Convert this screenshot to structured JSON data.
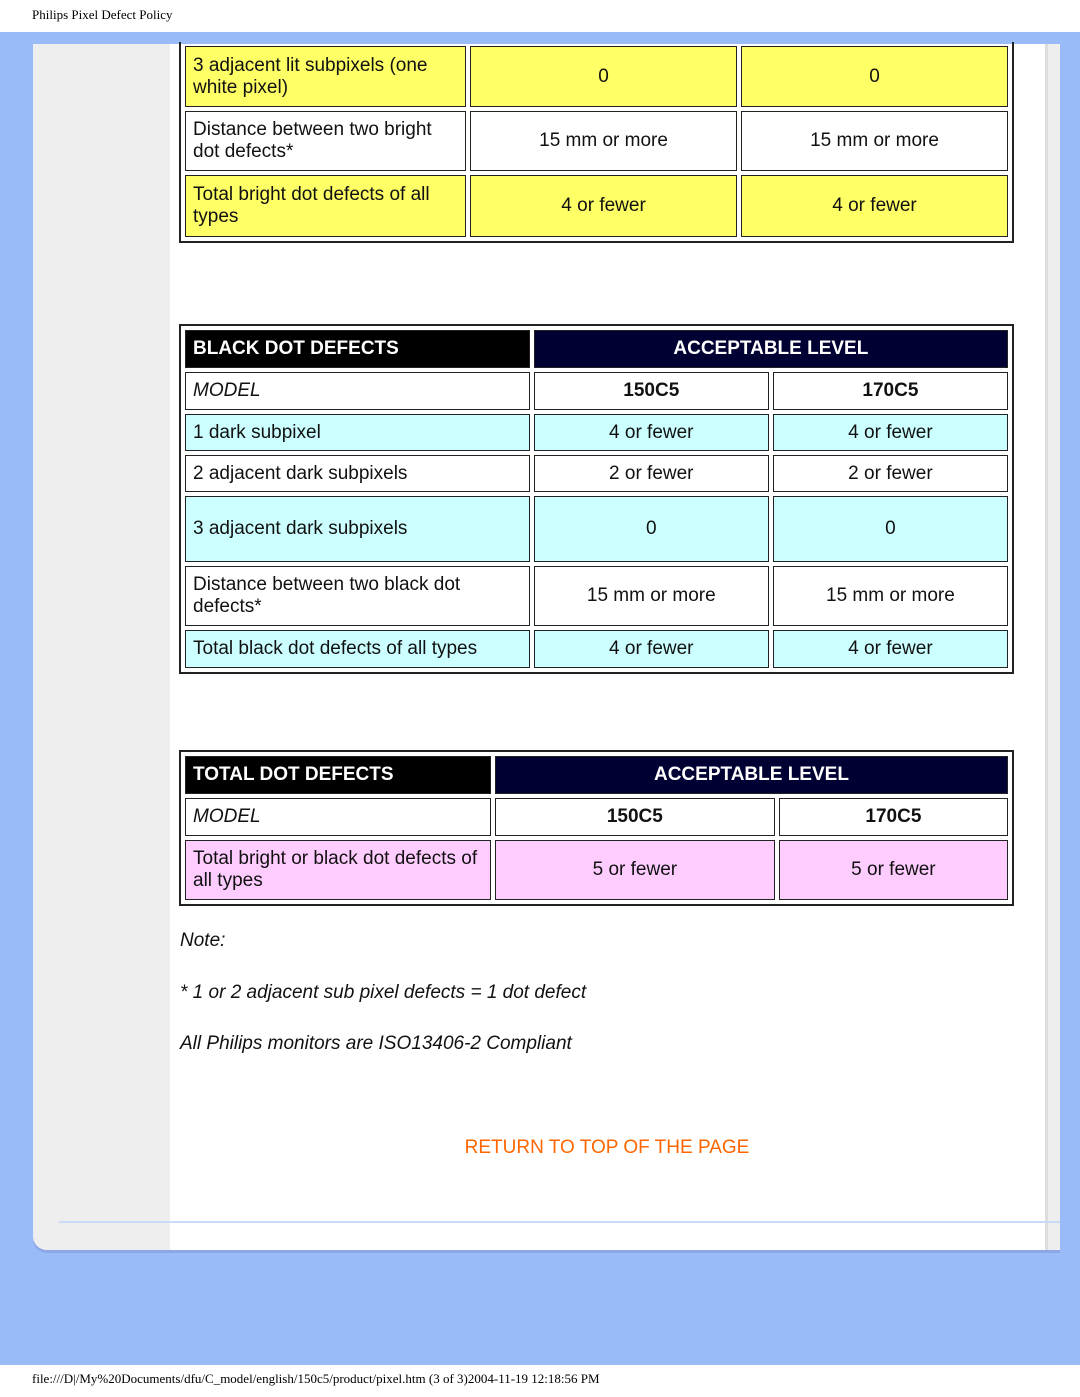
{
  "header": {
    "title": "Philips Pixel Defect Policy"
  },
  "bright_table": {
    "rows": [
      {
        "label": "3 adjacent lit subpixels (one white pixel)",
        "v150": "0",
        "v170": "0"
      },
      {
        "label": "Distance between two bright dot defects*",
        "v150": "15 mm or more",
        "v170": "15 mm or more"
      },
      {
        "label": "Total bright dot defects of all types",
        "v150": "4 or fewer",
        "v170": "4 or fewer"
      }
    ]
  },
  "black_table": {
    "title": "BLACK DOT DEFECTS",
    "level": "ACCEPTABLE LEVEL",
    "model_label": "MODEL",
    "models": [
      "150C5",
      "170C5"
    ],
    "rows": [
      {
        "label": "1 dark subpixel",
        "v150": "4 or fewer",
        "v170": "4 or fewer"
      },
      {
        "label": "2 adjacent dark subpixels",
        "v150": "2 or fewer",
        "v170": "2 or fewer"
      },
      {
        "label": "3 adjacent dark subpixels",
        "v150": "0",
        "v170": "0"
      },
      {
        "label": "Distance between two black dot defects*",
        "v150": "15 mm or more",
        "v170": "15 mm or more"
      },
      {
        "label": "Total black dot defects of all types",
        "v150": "4 or fewer",
        "v170": "4 or fewer"
      }
    ]
  },
  "total_table": {
    "title": "TOTAL DOT DEFECTS",
    "level": "ACCEPTABLE LEVEL",
    "model_label": "MODEL",
    "models": [
      "150C5",
      "170C5"
    ],
    "rows": [
      {
        "label": "Total bright or black dot defects of all types",
        "v150": "5 or fewer",
        "v170": "5 or fewer"
      }
    ]
  },
  "notes": {
    "heading": "Note:",
    "line1": "* 1 or 2 adjacent sub pixel defects = 1 dot defect",
    "line2": "All Philips monitors are ISO13406-2 Compliant"
  },
  "return_link": "RETURN TO TOP OF THE PAGE",
  "footer": "file:///D|/My%20Documents/dfu/C_model/english/150c5/product/pixel.htm (3 of 3)2004-11-19 12:18:56 PM",
  "colors": {
    "bright_row": "#ffff66",
    "black_row": "#ccffff",
    "total_row": "#ffccff",
    "header_dark": "#000033",
    "link": "#ff6600",
    "background": "#99bbf8"
  }
}
